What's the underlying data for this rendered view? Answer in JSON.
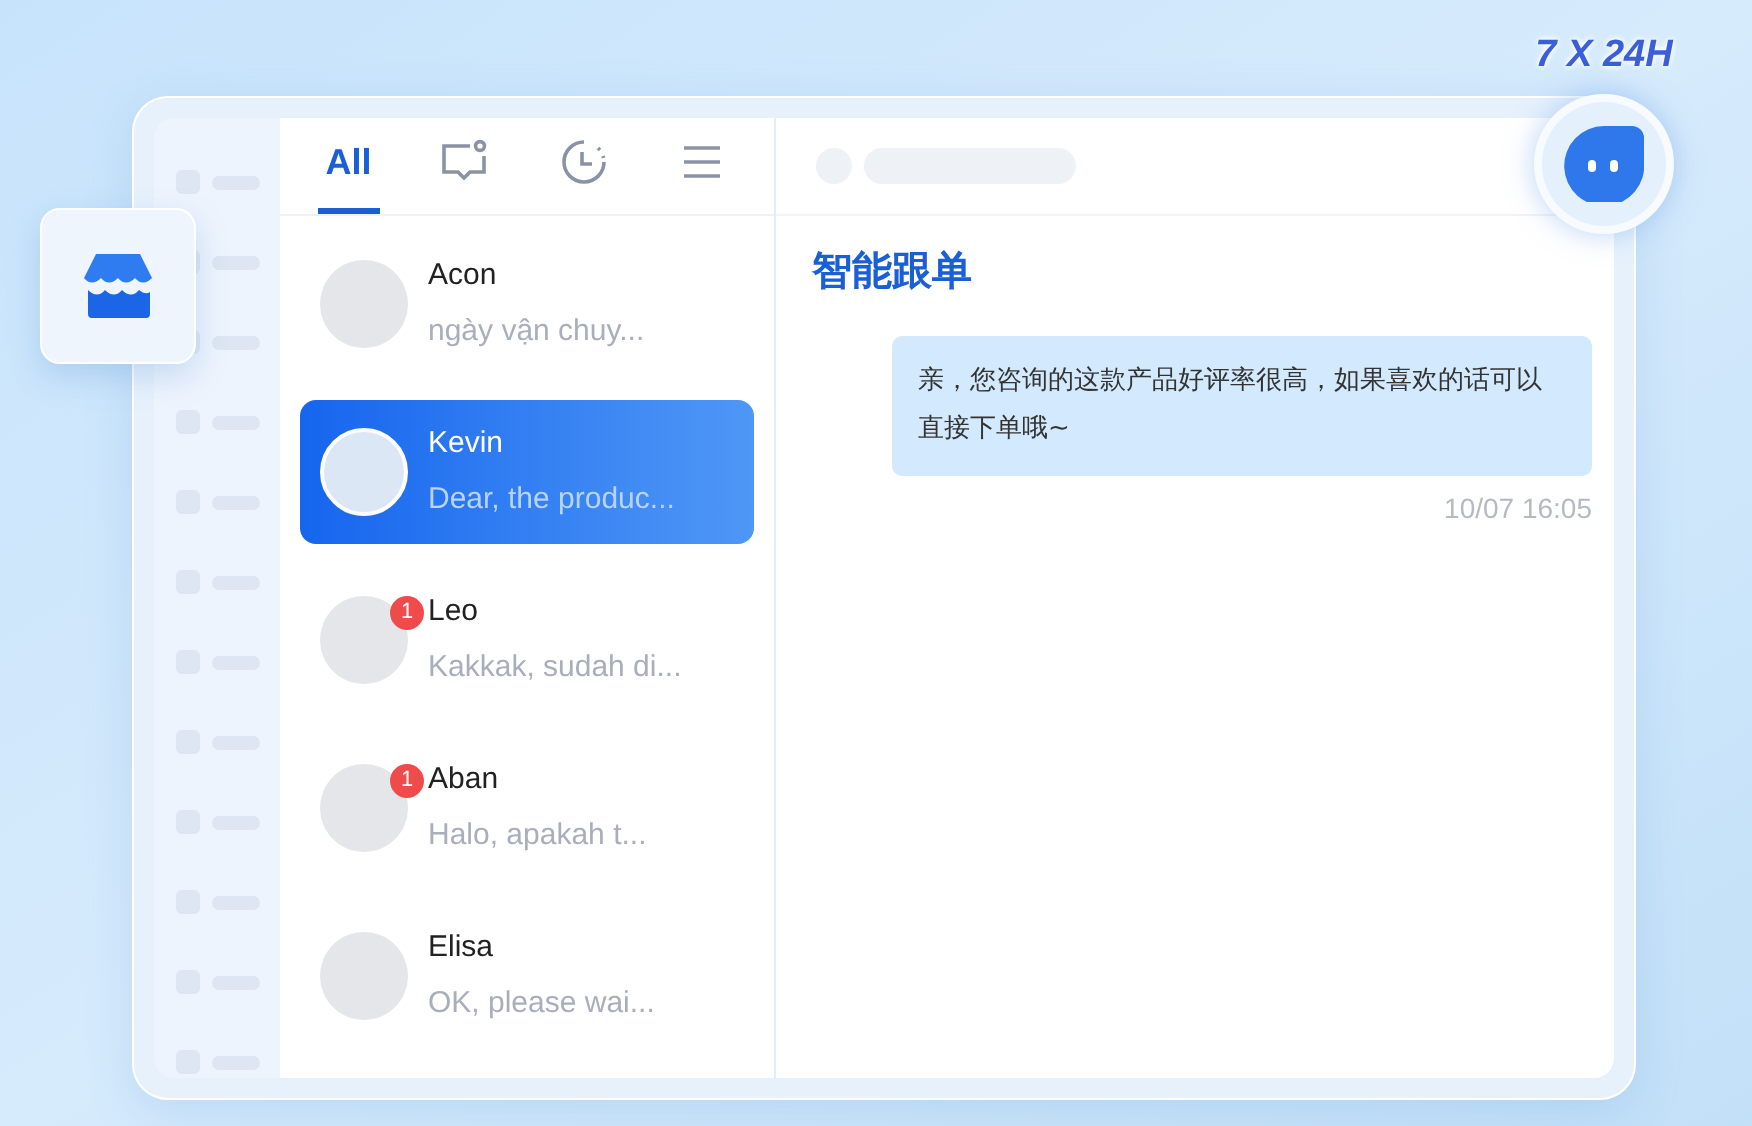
{
  "badge": {
    "label": "7 X 24H"
  },
  "tabs": [
    {
      "kind": "text",
      "label": "All",
      "selected": true
    },
    {
      "kind": "chat",
      "selected": false
    },
    {
      "kind": "clock",
      "selected": false
    },
    {
      "kind": "menu",
      "selected": false
    }
  ],
  "contacts": [
    {
      "name": "Acon",
      "preview": "ngày vận chuy...",
      "selected": false
    },
    {
      "name": "Kevin",
      "preview": "Dear, the produc...",
      "selected": true
    },
    {
      "name": "Leo",
      "preview": "Kakkak, sudah di...",
      "selected": false,
      "unread": "1"
    },
    {
      "name": "Aban",
      "preview": "Halo, apakah t...",
      "selected": false,
      "unread": "1"
    },
    {
      "name": "Elisa",
      "preview": "OK, please wai...",
      "selected": false
    }
  ],
  "chat": {
    "title": "智能跟单",
    "messages": [
      {
        "text": "亲，您咨询的这款产品好评率很高，如果喜欢的话可以直接下单哦~",
        "time": "10/07 16:05"
      }
    ]
  }
}
